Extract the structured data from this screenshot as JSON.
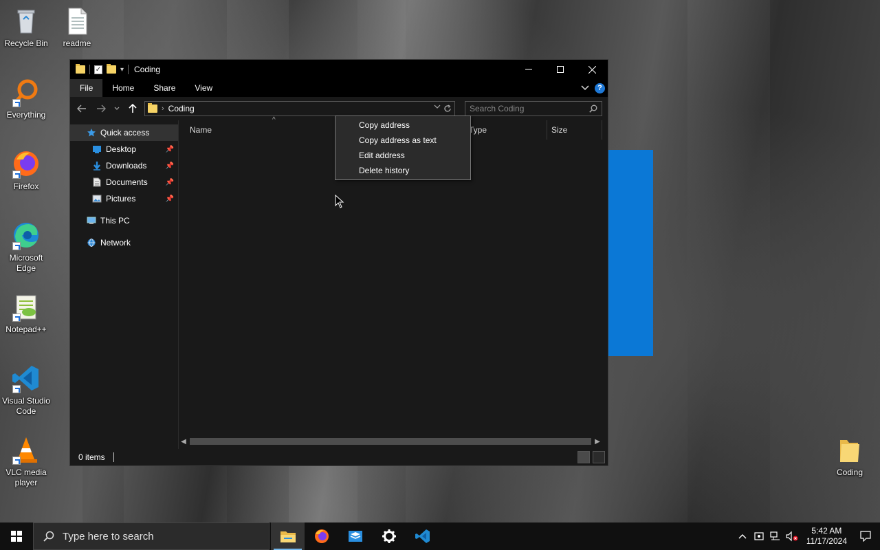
{
  "desktop": {
    "icons": [
      {
        "label": "Recycle Bin"
      },
      {
        "label": "readme"
      },
      {
        "label": "Everything"
      },
      {
        "label": "Firefox"
      },
      {
        "label": "Microsoft Edge"
      },
      {
        "label": "Notepad++"
      },
      {
        "label": "Visual Studio Code"
      },
      {
        "label": "VLC media player"
      },
      {
        "label": "Coding"
      }
    ]
  },
  "window": {
    "title": "Coding",
    "ribbon_tabs": [
      "File",
      "Home",
      "Share",
      "View"
    ],
    "help_label": "?",
    "address": {
      "crumb": "Coding",
      "separator": "›"
    },
    "search": {
      "placeholder": "Search Coding"
    },
    "nav": {
      "quick_access": "Quick access",
      "pinned": [
        "Desktop",
        "Downloads",
        "Documents",
        "Pictures"
      ],
      "this_pc": "This PC",
      "network": "Network"
    },
    "columns": [
      "Name",
      "Type",
      "Size"
    ],
    "status": "0 items"
  },
  "context_menu": {
    "items": [
      "Copy address",
      "Copy address as text",
      "Edit address",
      "Delete history"
    ]
  },
  "taskbar": {
    "search_placeholder": "Type here to search",
    "time": "5:42 AM",
    "date": "11/17/2024"
  },
  "colors": {
    "accent": "#0b78d6",
    "folder": "#f6d365",
    "window_bg": "#191919",
    "titlebar_bg": "#000000"
  }
}
